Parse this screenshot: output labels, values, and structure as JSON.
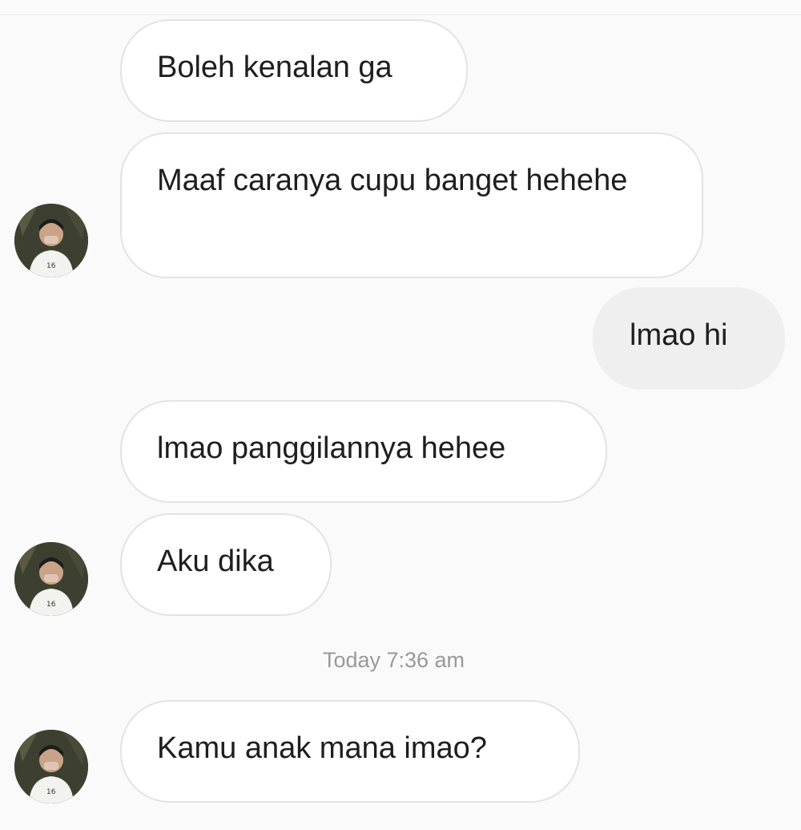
{
  "chat": {
    "messages": [
      {
        "text": "Boleh kenalan ga",
        "sender": "them"
      },
      {
        "text": "Maaf caranya cupu banget hehehe",
        "sender": "them"
      },
      {
        "text": "lmao hi",
        "sender": "me"
      },
      {
        "text": "lmao panggilannya hehee",
        "sender": "them"
      },
      {
        "text": "Aku dika",
        "sender": "them"
      },
      {
        "text": "Kamu anak mana imao?",
        "sender": "them"
      }
    ],
    "timestamp": "Today 7:36 am"
  },
  "avatar_icon": "profile-photo-icon",
  "colors": {
    "background": "#fafafa",
    "incoming_bubble": "#ffffff",
    "incoming_border": "#e3e3e3",
    "outgoing_bubble": "#efefef",
    "timestamp_text": "#999999"
  }
}
